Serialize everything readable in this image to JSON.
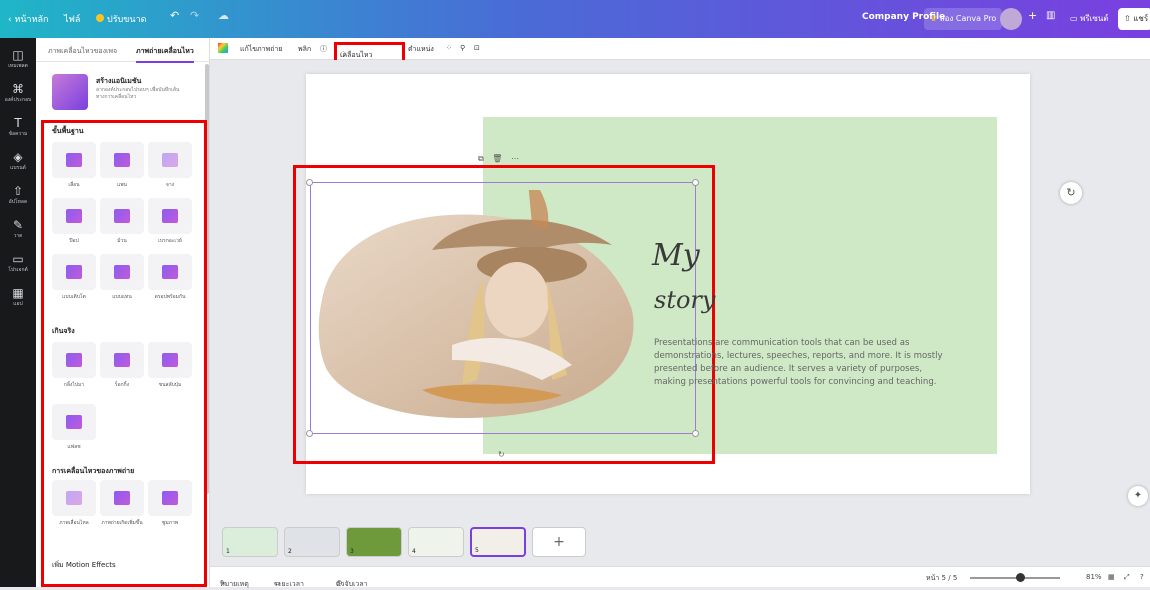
{
  "topbar": {
    "home": "หน้าหลัก",
    "file": "ไฟล์",
    "resize": "ปรับขนาด",
    "undo_icon": "undo-icon",
    "redo_icon": "redo-icon",
    "cloud_icon": "cloud-icon",
    "doc_title": "Company Profile",
    "try_pro": "ลอง Canva Pro",
    "plus": "+",
    "present": "พรีเซนต์",
    "share": "แชร์"
  },
  "rail": {
    "items": [
      {
        "icon": "template-icon",
        "glyph": "◫",
        "label": "เทมเพลต"
      },
      {
        "icon": "elements-icon",
        "glyph": "⌘",
        "label": "องค์ประกอบ"
      },
      {
        "icon": "text-icon",
        "glyph": "T",
        "label": "ข้อความ"
      },
      {
        "icon": "brand-icon",
        "glyph": "◈",
        "label": "แบรนด์"
      },
      {
        "icon": "upload-icon",
        "glyph": "⇧",
        "label": "อัปโหลด"
      },
      {
        "icon": "draw-icon",
        "glyph": "✎",
        "label": "วาด"
      },
      {
        "icon": "projects-icon",
        "glyph": "▭",
        "label": "โปรเจกต์"
      },
      {
        "icon": "apps-icon",
        "glyph": "▦",
        "label": "แอป"
      }
    ]
  },
  "panel": {
    "tab_page_animation": "ภาพเคลื่อนไหวของเพจ",
    "tab_photo_animation": "ภาพถ่ายเคลื่อนไหว",
    "promo_title": "สร้างแอนิเมชัน",
    "promo_desc": "ลากองค์ประกอบไปรอบๆ เพื่อบันทึกเส้นทางการเคลื่อนไหว",
    "section_basic": "ขั้นพื้นฐาน",
    "basic": [
      "เลื่อน",
      "แพน",
      "จาง",
      "ป๊อป",
      "ม้วน",
      "เบรกอะเวย์",
      "แบบเติบโต",
      "แบบแทน",
      "ดรอปพร้อมกัน"
    ],
    "section_exaggerate": "เกินจริง",
    "exaggerate": [
      "กลิ้งไปมา",
      "ร็อกกิ้ง",
      "ชนสลับปุ่ม",
      "แฟลช"
    ],
    "section_photo_motion": "การเคลื่อนไหวของภาพถ่าย",
    "photo_motion": [
      "ภาพเลื่อนไหล",
      "ภาพถ่ายเกิดเพิ่มขึ้น",
      "ซูมภาพ"
    ],
    "section_motion_effects": "เพิ่ม Motion Effects"
  },
  "ctxbar": {
    "edit_photo": "แก้ไขภาพถ่าย",
    "flip": "พลิก",
    "animate": "เคลื่อนไหว",
    "position": "ตำแหน่ง",
    "info_icon": "info-icon",
    "transparency_icon": "transparency-icon",
    "lock_icon": "lock-icon"
  },
  "slide": {
    "title_my": "My",
    "title_story": "story",
    "body": "Presentations are communication tools that can be used as demonstrations, lectures, speeches, reports, and more. It is mostly presented before an audience. It serves a variety of purposes, making presentations powerful tools for convincing and teaching."
  },
  "pages": [
    {
      "n": "1",
      "color": "#dbeedb"
    },
    {
      "n": "2",
      "color": "#dfe3e8"
    },
    {
      "n": "3",
      "color": "#6f9a3c"
    },
    {
      "n": "4",
      "color": "#eef4ec"
    },
    {
      "n": "5",
      "color": "#f1efe8"
    }
  ],
  "statusbar": {
    "notes": "หมายเหตุ",
    "duration": "ระยะเวลา",
    "timer": "ตัวจับเวลา",
    "page": "หน้า 5 / 5",
    "zoom": "81%"
  },
  "colors": {
    "accent": "#7a3fe0",
    "highlight": "#e00000",
    "slide_green": "#cfe9c6"
  }
}
